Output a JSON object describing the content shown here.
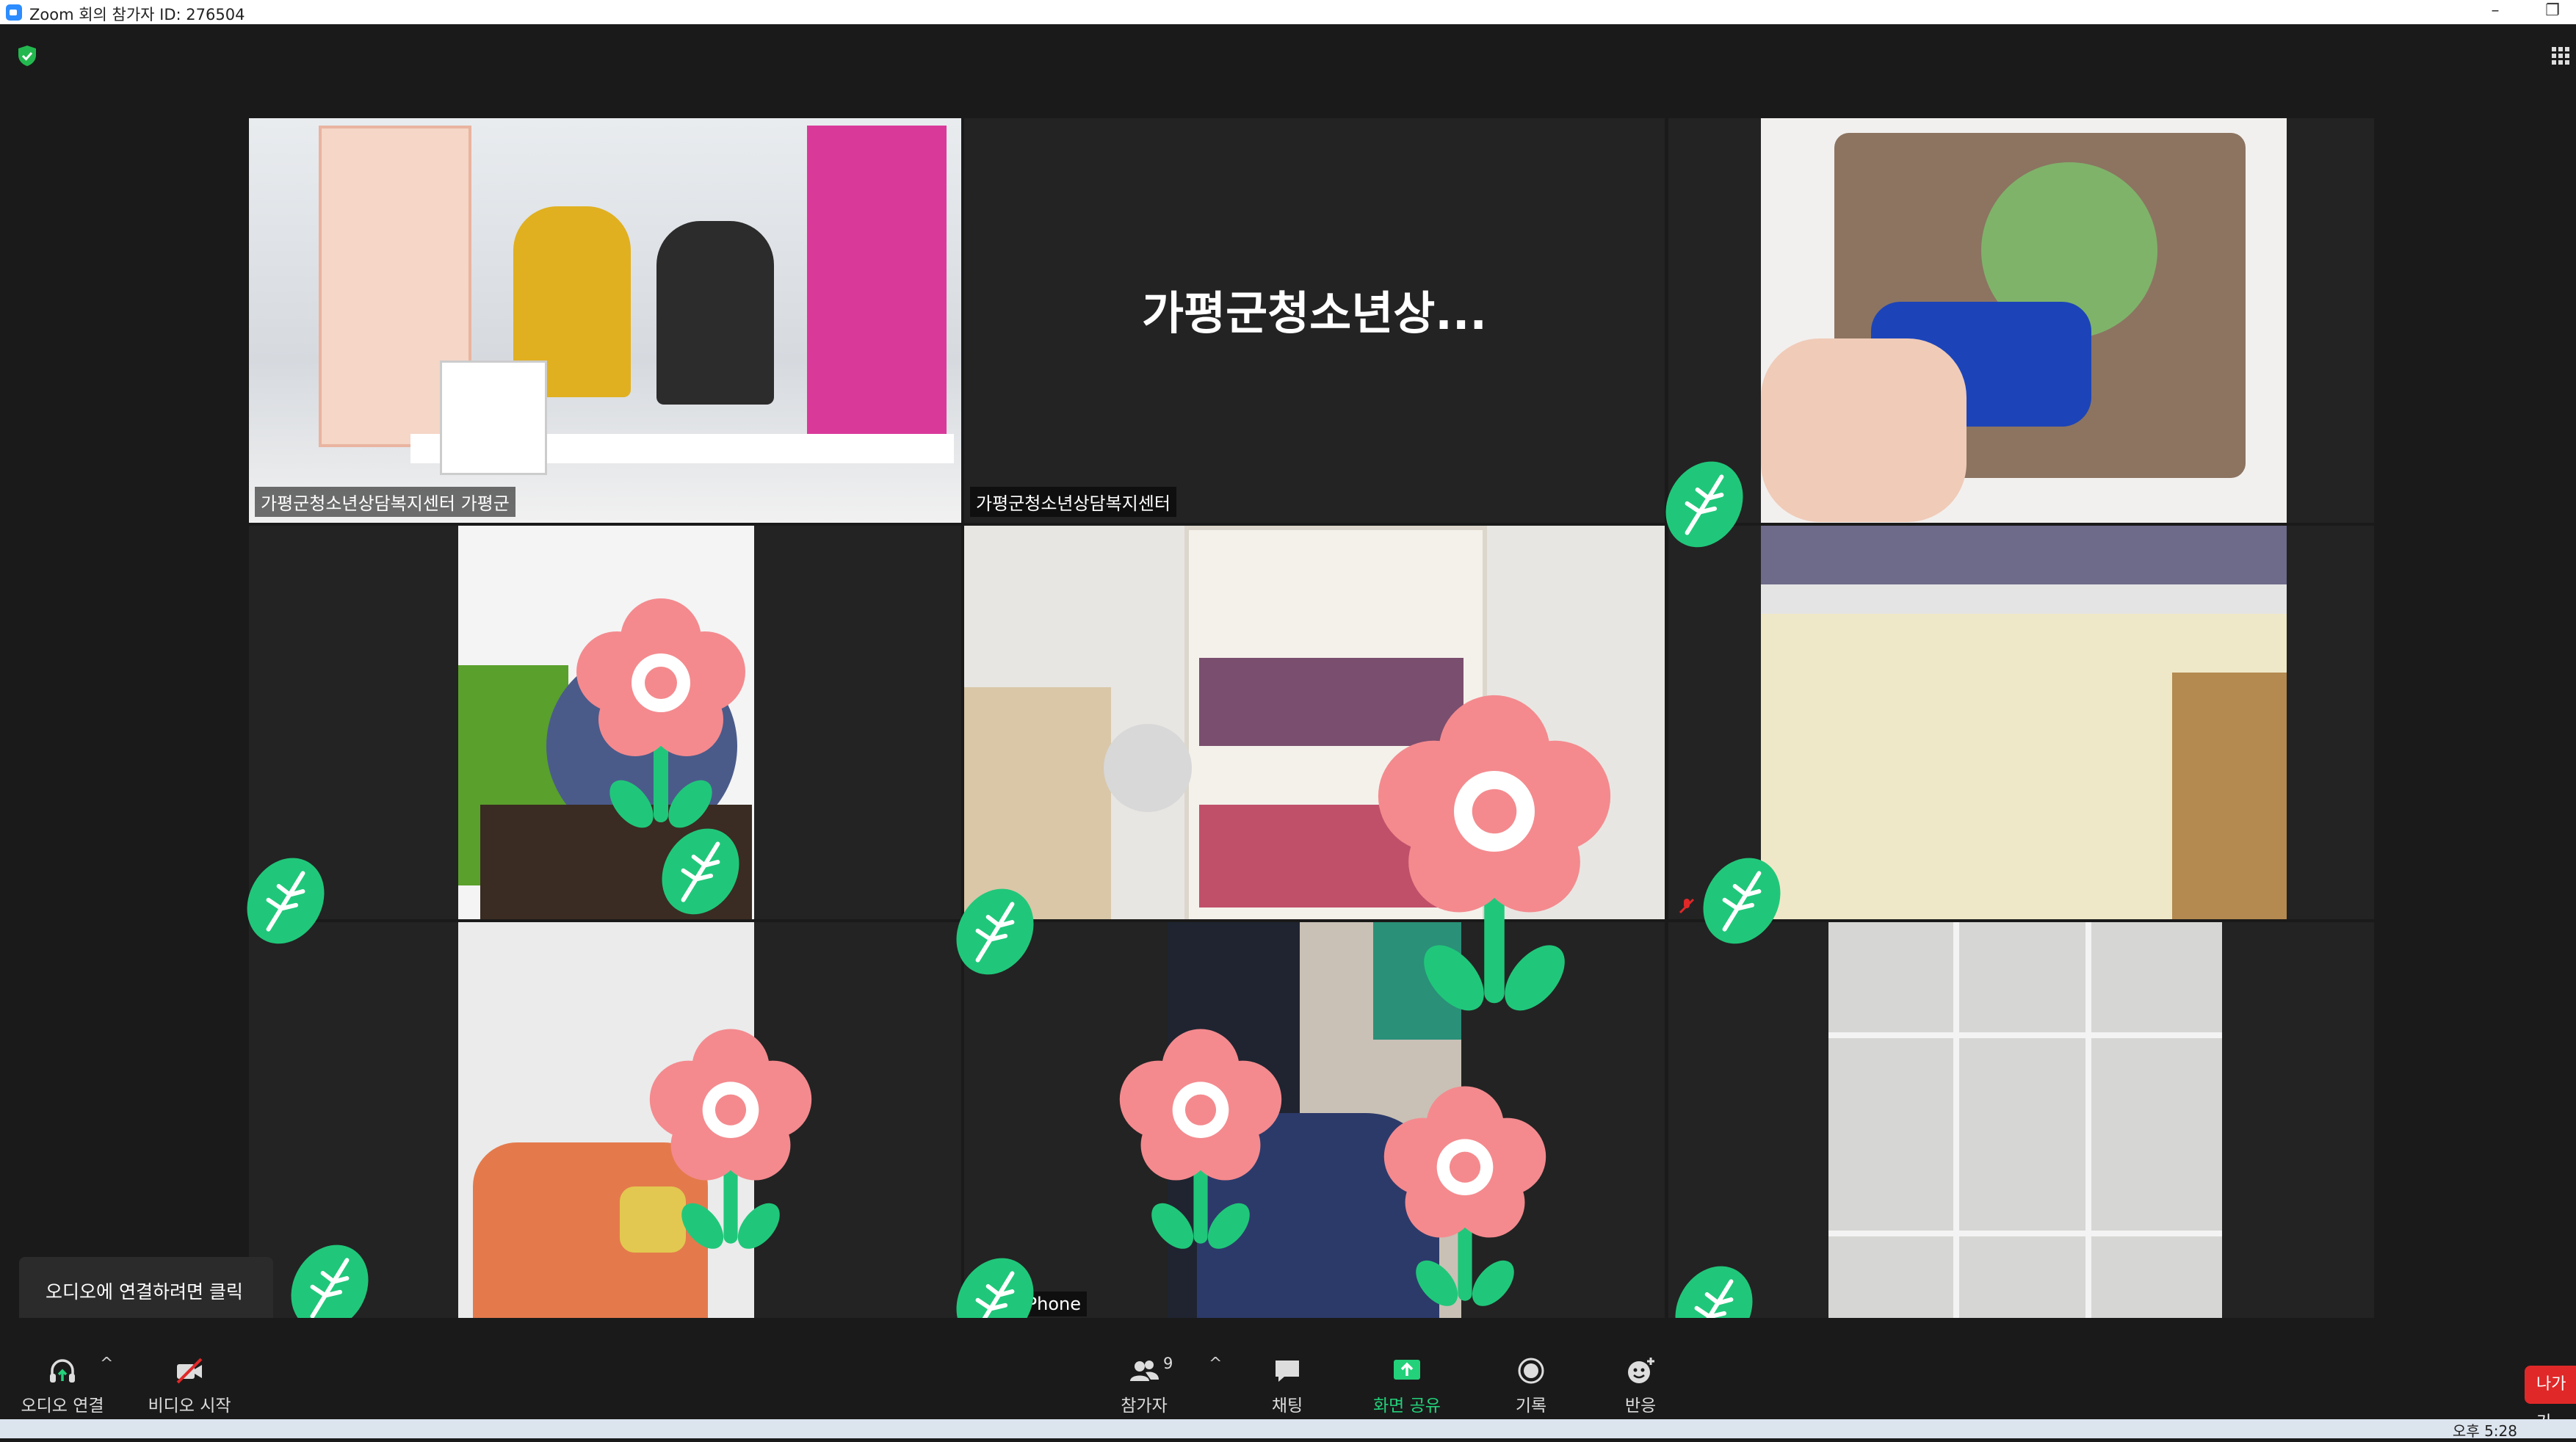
{
  "window": {
    "title": "Zoom 회의 참가자 ID: 276504",
    "minimize_glyph": "–",
    "restore_glyph": "❐"
  },
  "colors": {
    "active_speaker_border": "#c6e23b",
    "screen_share_green": "#23d17a",
    "leave_red": "#e02828",
    "sticker_green": "#20c77a",
    "sticker_pink": "#f48a8e"
  },
  "tiles": [
    {
      "label": "가평군청소년상담복지센터 가평군",
      "active": true
    },
    {
      "label": "가평군청소년상담복지센터",
      "display_name": "가평군청소년상...",
      "video_off": true
    },
    {
      "label": ""
    },
    {
      "label": ""
    },
    {
      "label": ""
    },
    {
      "label": ""
    },
    {
      "label": ""
    },
    {
      "label": "iPhone"
    },
    {
      "label": ""
    }
  ],
  "tooltip": {
    "text": "오디오에 연결하려면 클릭"
  },
  "toolbar": {
    "audio_label": "오디오 연결",
    "video_label": "비디오 시작",
    "participants_label": "참가자",
    "participants_count": "9",
    "chat_label": "채팅",
    "share_label": "화면 공유",
    "record_label": "기록",
    "reactions_label": "반응",
    "leave_label": "나가기",
    "caret": "^"
  },
  "taskbar": {
    "clock": "오후 5:28"
  },
  "icons": [
    "shield-icon",
    "gallery-grid-icon",
    "headphone-icon",
    "video-off-icon",
    "participants-icon",
    "chat-icon",
    "share-screen-icon",
    "record-icon",
    "reaction-icon",
    "mute-icon",
    "leaf-sticker",
    "flower-sticker"
  ]
}
